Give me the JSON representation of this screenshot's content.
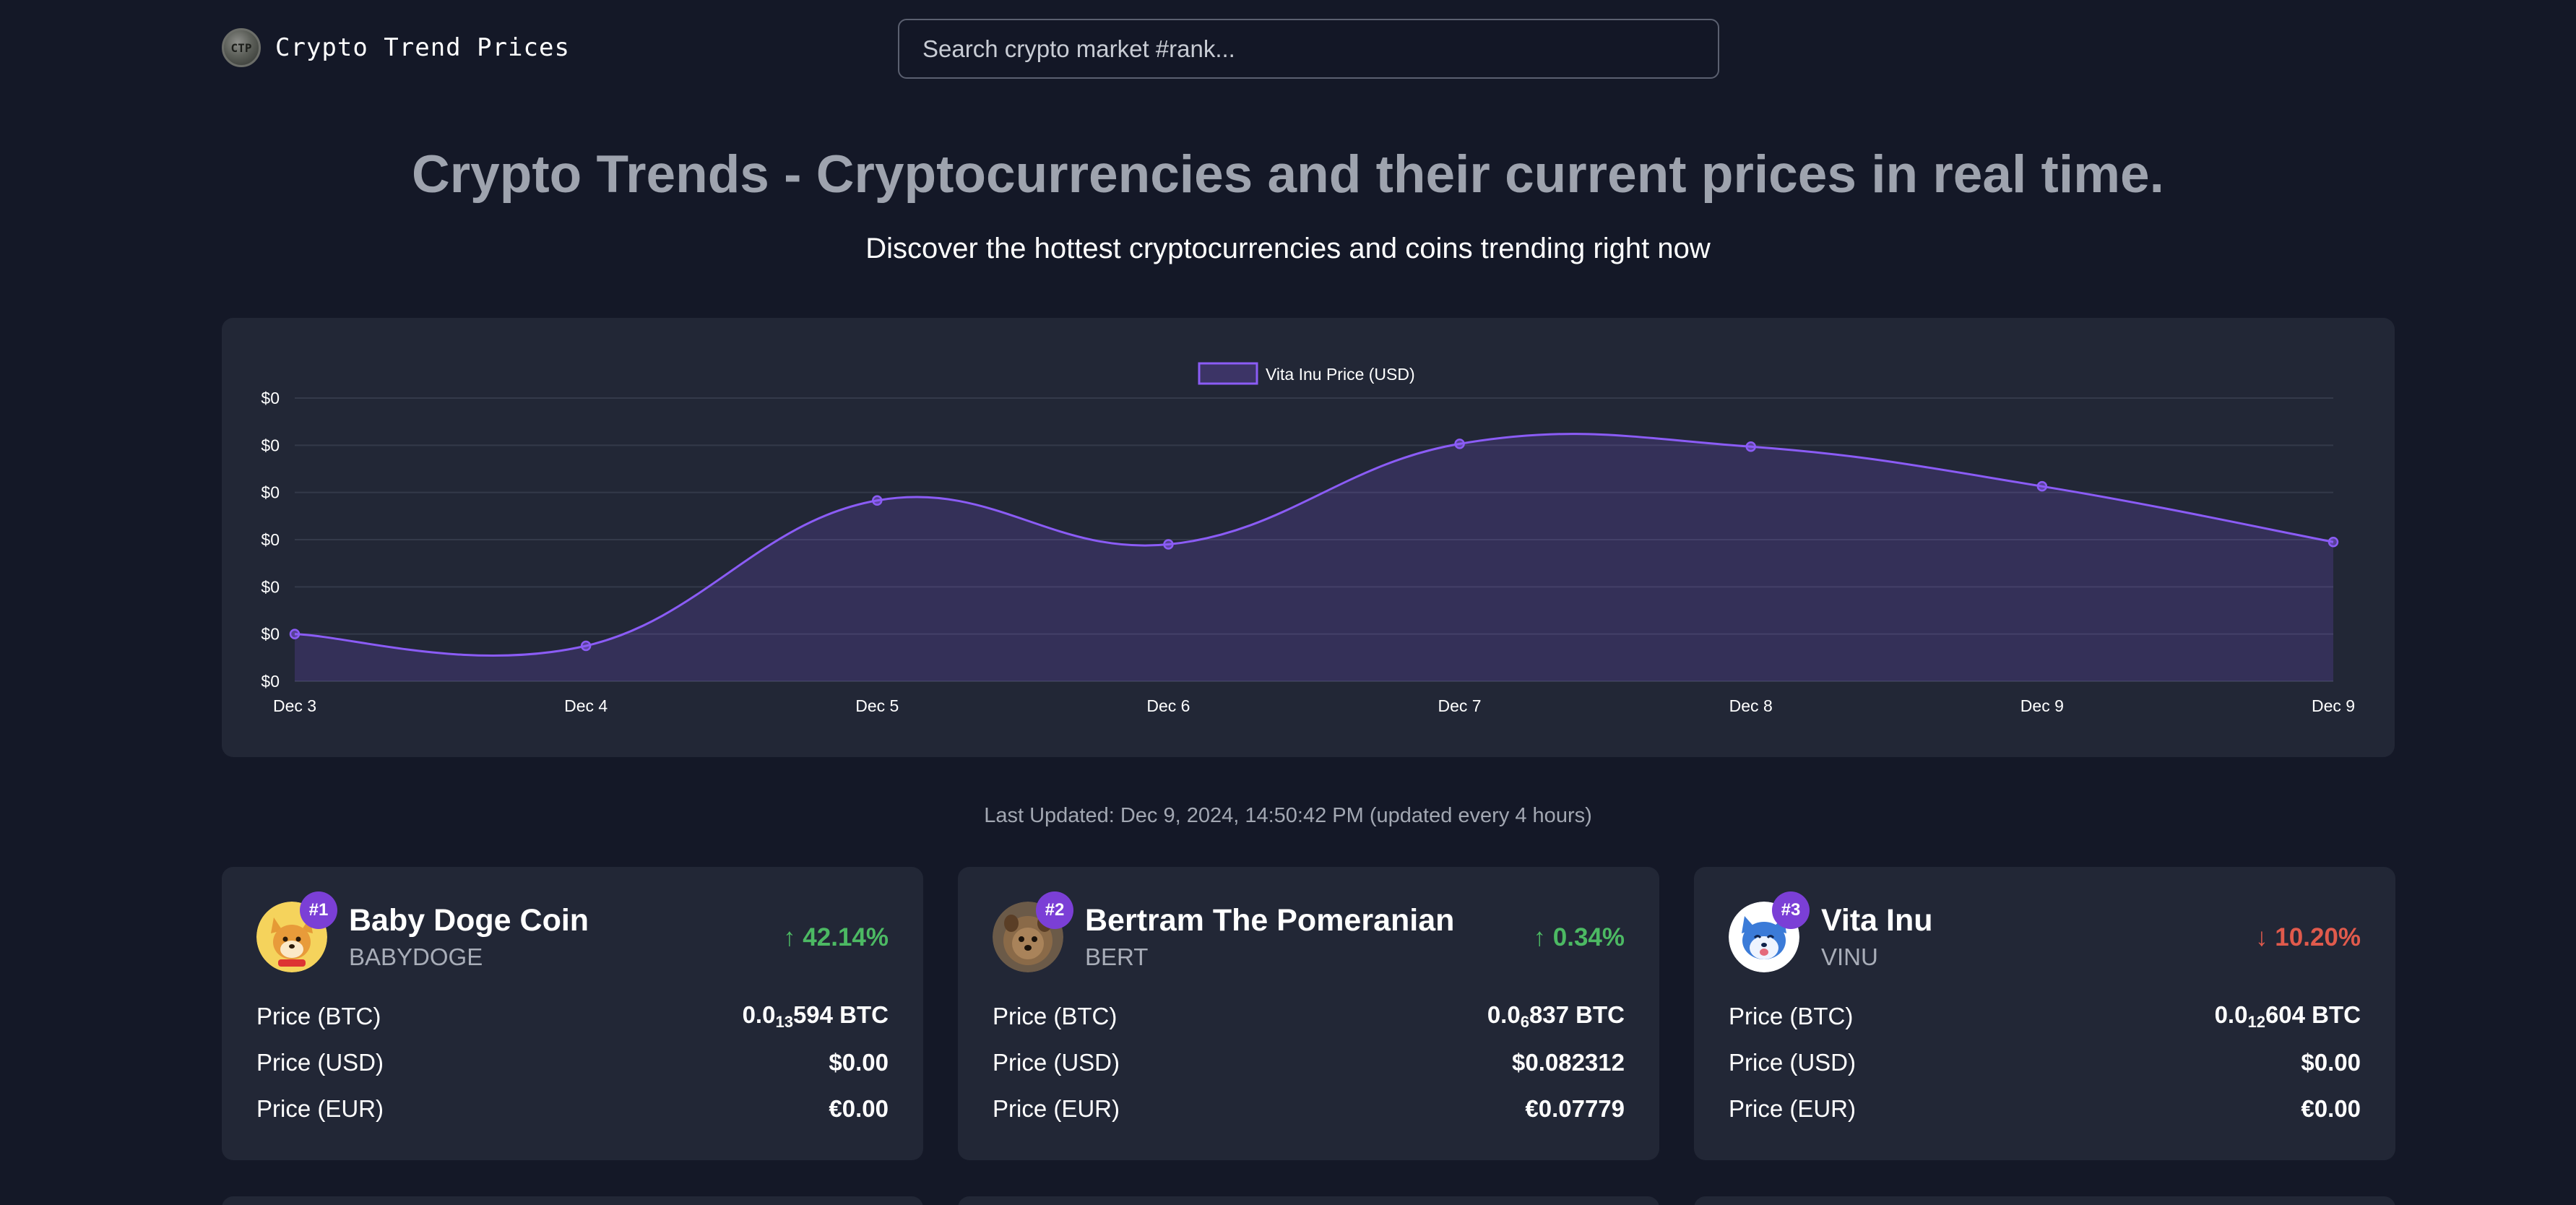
{
  "header": {
    "logo_mark": "CTP",
    "logo_text": "Crypto Trend Prices",
    "search_placeholder": "Search crypto market #rank..."
  },
  "hero": {
    "title": "Crypto Trends - Cryptocurrencies and their current prices in real time.",
    "subtitle": "Discover the hottest cryptocurrencies and coins trending right now"
  },
  "colors": {
    "background": "#141827",
    "card": "#222736",
    "line": "#8b5cf6",
    "up": "#4cb963",
    "down": "#e05a4c",
    "badge": "#7b3fd6"
  },
  "chart_data": {
    "type": "line",
    "legend_label": "Vita Inu Price (USD)",
    "legend_position": "top-center",
    "categories": [
      "Dec 3",
      "Dec 4",
      "Dec 5",
      "Dec 6",
      "Dec 7",
      "Dec 8",
      "Dec 9",
      "Dec 9"
    ],
    "y_tick_labels": [
      "$0",
      "$0",
      "$0",
      "$0",
      "$0",
      "$0",
      "$0"
    ],
    "y_ticks_relative": [
      6,
      5,
      4,
      3,
      2,
      1,
      0
    ],
    "series": [
      {
        "name": "Vita Inu Price (USD)",
        "values_relative": [
          1.0,
          0.75,
          3.83,
          2.9,
          5.03,
          4.97,
          4.13,
          2.95
        ]
      }
    ],
    "fill": true,
    "grid": true
  },
  "last_updated": "Last Updated: Dec 9, 2024, 14:50:42 PM (updated every 4 hours)",
  "labels": {
    "price_btc": "Price (BTC)",
    "price_usd": "Price (USD)",
    "price_eur": "Price (EUR)"
  },
  "coins": [
    {
      "rank": "#1",
      "name": "Baby Doge Coin",
      "symbol": "BABYDOGE",
      "change": "↑ 42.14%",
      "direction": "up",
      "btc_prefix": "0.0",
      "btc_zeros": "13",
      "btc_digits": "594 BTC",
      "usd": "$0.00",
      "eur": "€0.00",
      "icon": "shiba-dog-icon"
    },
    {
      "rank": "#2",
      "name": "Bertram The Pomeranian",
      "symbol": "BERT",
      "change": "↑ 0.34%",
      "direction": "up",
      "btc_prefix": "0.0",
      "btc_zeros": "6",
      "btc_digits": "837 BTC",
      "usd": "$0.082312",
      "eur": "€0.07779",
      "icon": "pomeranian-dog-icon"
    },
    {
      "rank": "#3",
      "name": "Vita Inu",
      "symbol": "VINU",
      "change": "↓ 10.20%",
      "direction": "down",
      "btc_prefix": "0.0",
      "btc_zeros": "12",
      "btc_digits": "604 BTC",
      "usd": "$0.00",
      "eur": "€0.00",
      "icon": "husky-dog-icon"
    }
  ]
}
